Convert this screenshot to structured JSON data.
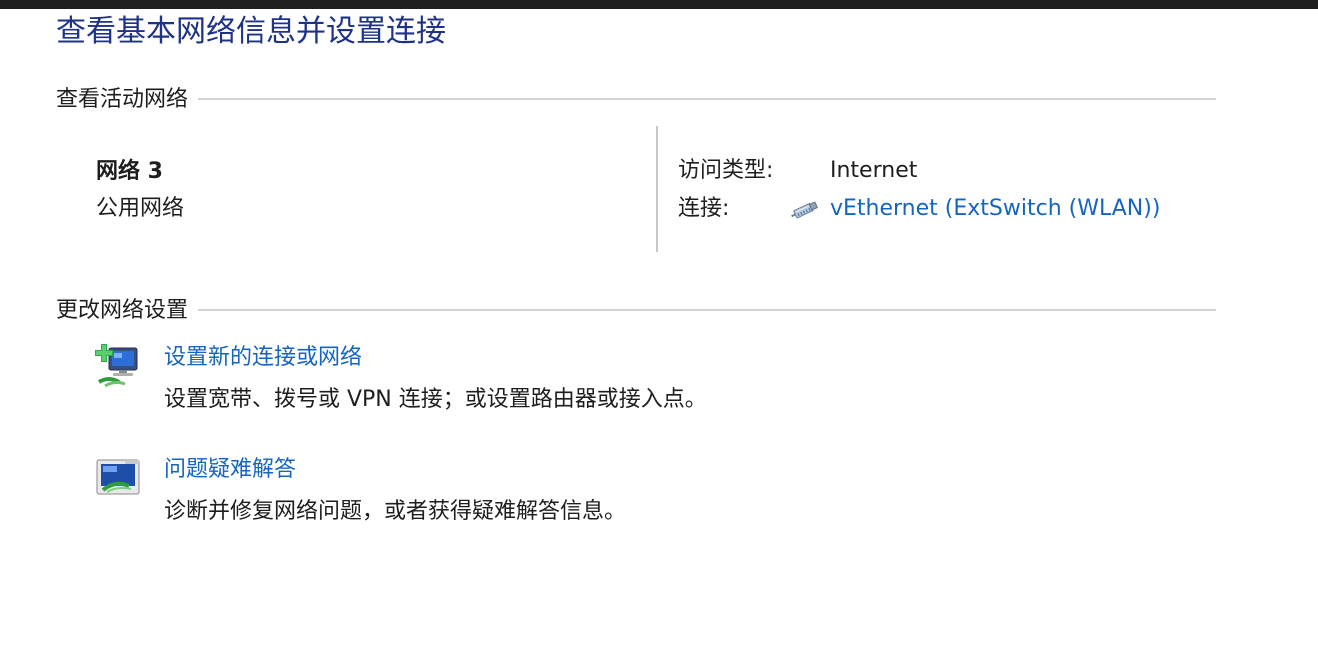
{
  "page": {
    "title": "查看基本网络信息并设置连接"
  },
  "active_networks": {
    "heading": "查看活动网络",
    "network_name": "网络 3",
    "network_category": "公用网络",
    "access_type_label": "访问类型:",
    "access_type_value": "Internet",
    "connections_label": "连接:",
    "connection_name": "vEthernet (ExtSwitch (WLAN))",
    "connection_icon": "ethernet-cable-icon"
  },
  "change_settings": {
    "heading": "更改网络设置",
    "tasks": [
      {
        "link": "设置新的连接或网络",
        "description": "设置宽带、拨号或 VPN 连接；或设置路由器或接入点。",
        "icon": "new-connection-icon"
      },
      {
        "link": "问题疑难解答",
        "description": "诊断并修复网络问题，或者获得疑难解答信息。",
        "icon": "troubleshoot-icon"
      }
    ]
  },
  "colors": {
    "title": "#1e3287",
    "link": "#1565c0",
    "text": "#1e1e1e",
    "rule": "#d4d4d4"
  }
}
